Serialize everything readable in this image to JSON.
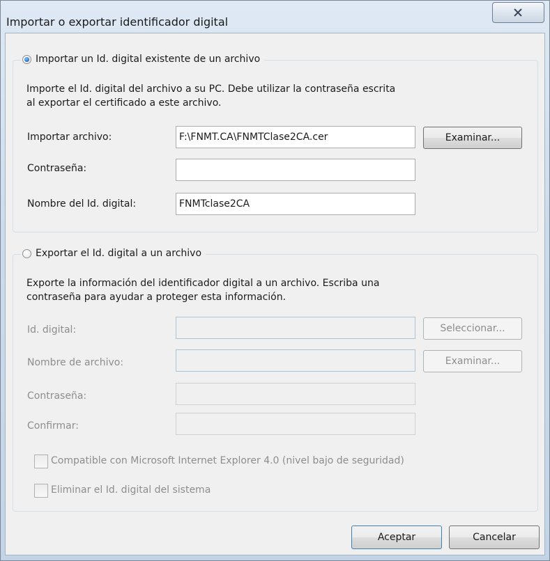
{
  "window": {
    "title": "Importar o exportar identificador digital"
  },
  "import_group": {
    "radio_label": "Importar un Id. digital existente de un archivo",
    "selected": true,
    "description_line1": "Importe el Id. digital del archivo a su PC. Debe utilizar la contraseña escrita",
    "description_line2": "al exportar el certificado a este archivo.",
    "file_label": "Importar archivo:",
    "file_value": "F:\\FNMT.CA\\FNMTClase2CA.cer",
    "browse_label": "Examinar...",
    "password_label": "Contraseña:",
    "password_value": "",
    "name_label": "Nombre del Id. digital:",
    "name_value": "FNMTclase2CA"
  },
  "export_group": {
    "radio_label": "Exportar el Id. digital a un archivo",
    "selected": false,
    "description_line1": "Exporte la información del identificador digital a un archivo. Escriba una",
    "description_line2": "contraseña para ayudar a proteger esta información.",
    "id_label": "Id. digital:",
    "id_value": "",
    "select_label": "Seleccionar...",
    "filename_label": "Nombre de archivo:",
    "filename_value": "",
    "browse_label": "Examinar...",
    "password_label": "Contraseña:",
    "password_value": "",
    "confirm_label": "Confirmar:",
    "confirm_value": "",
    "compat_label": "Compatible con Microsoft Internet Explorer 4.0 (nivel bajo de seguridad)",
    "compat_checked": false,
    "remove_label": "Eliminar el Id. digital del sistema",
    "remove_checked": false
  },
  "footer": {
    "ok_label": "Aceptar",
    "cancel_label": "Cancelar"
  },
  "icons": {
    "close": "close-x-icon",
    "radio": "radio-button",
    "checkbox": "checkbox"
  }
}
